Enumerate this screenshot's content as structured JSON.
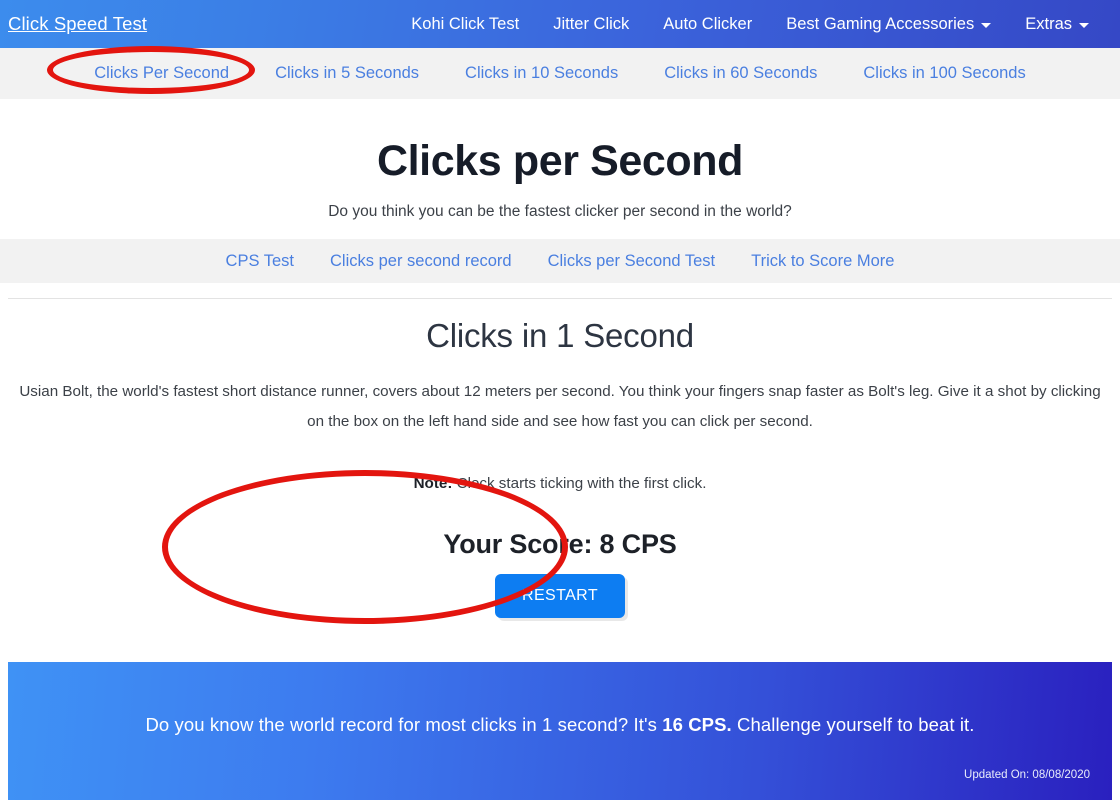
{
  "header": {
    "brand": "Click Speed Test",
    "nav": [
      {
        "label": "Kohi Click Test",
        "dropdown": false
      },
      {
        "label": "Jitter Click",
        "dropdown": false
      },
      {
        "label": "Auto Clicker",
        "dropdown": false
      },
      {
        "label": "Best Gaming Accessories",
        "dropdown": true
      },
      {
        "label": "Extras",
        "dropdown": true
      }
    ]
  },
  "subnav": {
    "items": [
      {
        "label": "Clicks Per Second",
        "active": true
      },
      {
        "label": "Clicks in 5 Seconds",
        "active": false
      },
      {
        "label": "Clicks in 10 Seconds",
        "active": false
      },
      {
        "label": "Clicks in 60 Seconds",
        "active": false
      },
      {
        "label": "Clicks in 100 Seconds",
        "active": false
      }
    ]
  },
  "hero": {
    "title": "Clicks per Second",
    "subtitle": "Do you think you can be the fastest clicker per second in the world?"
  },
  "linkstrip": {
    "links": [
      "CPS Test",
      "Clicks per second record",
      "Clicks per Second Test",
      "Trick to Score More"
    ]
  },
  "main": {
    "section_title": "Clicks in 1 Second",
    "paragraph": "Usian Bolt, the world's fastest short distance runner, covers about 12 meters per second. You think your fingers snap faster as Bolt's leg. Give it a shot by clicking on the box on the left hand side and see how fast you can click per second.",
    "note_label": "Note:",
    "note_text": " Clock starts ticking with the first click.",
    "score_text": "Your Score: 8 CPS",
    "score_value": 8,
    "score_unit": "CPS",
    "restart_label": "RESTART"
  },
  "banner": {
    "text_before": "Do you know the world record for most clicks in 1 second? It's ",
    "highlight": "16 CPS.",
    "text_after": " Challenge yourself to beat it.",
    "record_value": 16,
    "updated": "Updated On: 08/08/2020"
  },
  "annotations": {
    "ellipse_color": "#e3150f",
    "targets": [
      "Clicks Per Second",
      "Your Score: 8 CPS"
    ]
  },
  "colors": {
    "accent_blue": "#0d7df2",
    "link_blue": "#4a7fe0",
    "nav_gradient_start": "#3c8ced",
    "nav_gradient_end": "#3548c6",
    "banner_gradient_start": "#3f92f5",
    "banner_gradient_end": "#2a20bf",
    "annotation_red": "#e3150f"
  }
}
